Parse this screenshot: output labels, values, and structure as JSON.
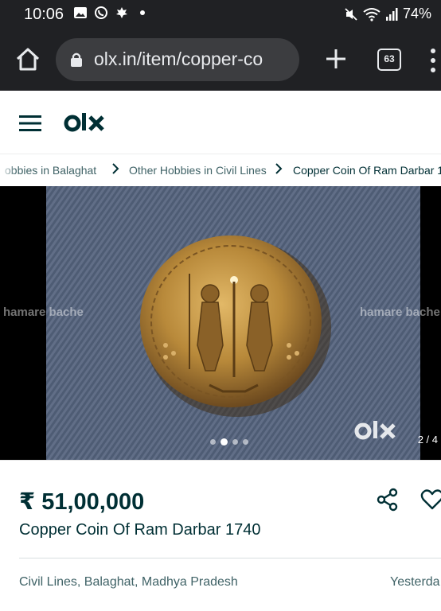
{
  "status_bar": {
    "time": "10:06",
    "battery": "74%"
  },
  "browser": {
    "url": "olx.in/item/copper-co",
    "tab_count": "63"
  },
  "breadcrumb": {
    "items": [
      "obbies in Balaghat",
      "Other Hobbies in Civil Lines",
      "Copper Coin Of Ram Darbar 1"
    ]
  },
  "gallery": {
    "counter": "2 / 4",
    "current_index": 2,
    "total": 4,
    "watermark_text": "hamare bache",
    "photo_logo": "olx"
  },
  "listing": {
    "price": "₹ 51,00,000",
    "title": "Copper Coin Of Ram Darbar 1740",
    "location": "Civil Lines, Balaghat, Madhya Pradesh",
    "posted": "Yesterda"
  },
  "colors": {
    "browser_bg": "#202124",
    "url_pill": "#3c3d40",
    "olx_text": "#002f34",
    "secondary_text": "#406367",
    "coin_gold": "#b8893a"
  }
}
